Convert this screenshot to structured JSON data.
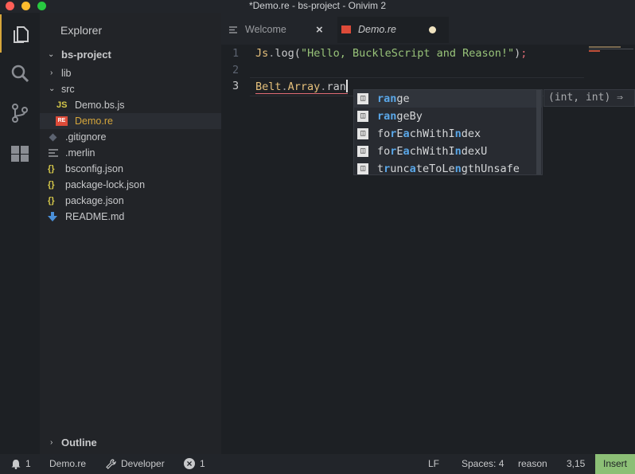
{
  "window": {
    "title": "*Demo.re - bs-project - Onivim 2"
  },
  "activity_bar": {
    "icons": [
      "files-icon",
      "search-icon",
      "source-control-icon",
      "extensions-icon"
    ]
  },
  "explorer": {
    "header": "Explorer",
    "project": "bs-project",
    "items": [
      {
        "label": "lib",
        "kind": "folder",
        "expanded": false
      },
      {
        "label": "src",
        "kind": "folder",
        "expanded": true
      },
      {
        "label": "Demo.bs.js",
        "kind": "js-file",
        "icon_text": "JS"
      },
      {
        "label": "Demo.re",
        "kind": "reason-file",
        "icon_text": "RE",
        "selected": true
      },
      {
        "label": ".gitignore",
        "kind": "git-file"
      },
      {
        "label": ".merlin",
        "kind": "text-file"
      },
      {
        "label": "bsconfig.json",
        "kind": "json-file",
        "icon_text": "{}"
      },
      {
        "label": "package-lock.json",
        "kind": "json-file",
        "icon_text": "{}"
      },
      {
        "label": "package.json",
        "kind": "json-file",
        "icon_text": "{}"
      },
      {
        "label": "README.md",
        "kind": "markdown-file"
      }
    ],
    "outline_label": "Outline"
  },
  "tabs": [
    {
      "label": "Welcome",
      "active": false,
      "close": "×"
    },
    {
      "label": "Demo.re",
      "active": true,
      "modified": true
    }
  ],
  "editor": {
    "lines": [
      {
        "number": "1",
        "tokens": {
          "obj": "Js",
          "dot": ".",
          "fn": "log",
          "open": "(",
          "str": "\"Hello, BuckleScript and Reason!\"",
          "close": ")",
          "semi": ";"
        }
      },
      {
        "number": "2"
      },
      {
        "number": "3",
        "tokens": {
          "a": "Belt",
          "d1": ".",
          "b": "Array",
          "d2": ".",
          "c": "ran"
        }
      }
    ]
  },
  "suggestions": {
    "items": [
      {
        "label": "range",
        "parts": [
          {
            "t": "ran",
            "m": true
          },
          {
            "t": "ge",
            "m": false
          }
        ],
        "selected": true
      },
      {
        "label": "rangeBy",
        "parts": [
          {
            "t": "ran",
            "m": true
          },
          {
            "t": "geBy",
            "m": false
          }
        ]
      },
      {
        "label": "forEachWithIndex",
        "parts": [
          {
            "t": "fo",
            "m": false
          },
          {
            "t": "r",
            "m": true
          },
          {
            "t": "E",
            "m": false
          },
          {
            "t": "a",
            "m": true
          },
          {
            "t": "chWithI",
            "m": false
          },
          {
            "t": "n",
            "m": true
          },
          {
            "t": "dex",
            "m": false
          }
        ]
      },
      {
        "label": "forEachWithIndexU",
        "parts": [
          {
            "t": "fo",
            "m": false
          },
          {
            "t": "r",
            "m": true
          },
          {
            "t": "E",
            "m": false
          },
          {
            "t": "a",
            "m": true
          },
          {
            "t": "chWithI",
            "m": false
          },
          {
            "t": "n",
            "m": true
          },
          {
            "t": "dexU",
            "m": false
          }
        ]
      },
      {
        "label": "truncateToLengthUnsafe",
        "parts": [
          {
            "t": "t",
            "m": false
          },
          {
            "t": "r",
            "m": true
          },
          {
            "t": "unc",
            "m": false
          },
          {
            "t": "a",
            "m": true
          },
          {
            "t": "teToLe",
            "m": false
          },
          {
            "t": "n",
            "m": true
          },
          {
            "t": "gthUnsafe",
            "m": false
          }
        ]
      }
    ],
    "detail": "(int, int) ⇒"
  },
  "statusbar": {
    "notifications": "1",
    "file": "Demo.re",
    "developer": "Developer",
    "errors": "1",
    "eol": "LF",
    "indent": "Spaces: 4",
    "language": "reason",
    "position": "3,15",
    "mode": "Insert"
  },
  "colors": {
    "accent": "#d6a63b",
    "insert_mode": "#8cbf76",
    "string": "#98c379",
    "object": "#e5c07b",
    "match": "#5aa7e8",
    "error": "#e06c75"
  }
}
